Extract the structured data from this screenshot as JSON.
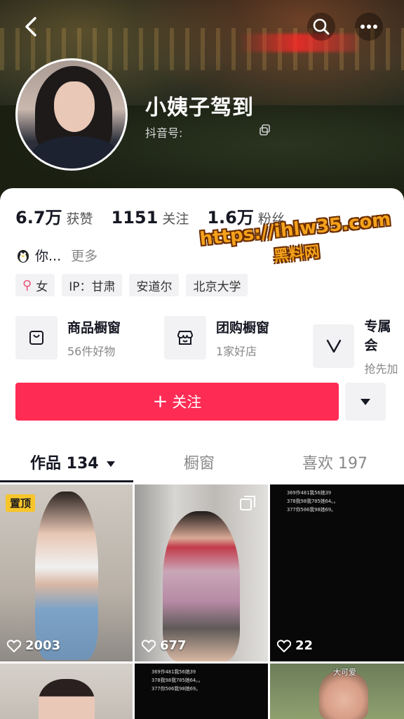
{
  "header": {
    "back_icon": "back-chevron-icon",
    "search_icon": "search-icon",
    "more_icon": "more-dots-icon"
  },
  "profile": {
    "nickname": "小姨子驾到",
    "douyin_id_label": "抖音号:",
    "stats": [
      {
        "num": "6.7万",
        "label": "获赞"
      },
      {
        "num": "1151",
        "label": "关注"
      },
      {
        "num": "1.6万",
        "label": "粉丝"
      }
    ],
    "bio_text": "你...",
    "bio_more": "更多",
    "tags": {
      "gender": "女",
      "ip": "IP：甘肃",
      "location": "安道尔",
      "school": "北京大学"
    }
  },
  "watermark": {
    "url": "https://ihlw35.com",
    "cn": "黑料网"
  },
  "shop": [
    {
      "title": "商品橱窗",
      "sub": "56件好物",
      "icon": "bag-icon"
    },
    {
      "title": "团购橱窗",
      "sub": "1家好店",
      "icon": "store-icon"
    },
    {
      "title": "专属会",
      "sub": "抢先加",
      "icon": "v-icon"
    }
  ],
  "actions": {
    "follow_label": "关注",
    "follow_plus": "+"
  },
  "tabs": [
    {
      "label": "作品 134"
    },
    {
      "label": "橱窗"
    },
    {
      "label": "喜欢 197"
    }
  ],
  "videos": [
    {
      "likes": "2003",
      "pin": "置顶"
    },
    {
      "likes": "677"
    },
    {
      "likes": "22",
      "overlay": [
        "369作481我56她39",
        "378我98我705她64。。",
        "377你506我98她69。"
      ]
    },
    {
      "likes": ""
    },
    {
      "likes": "",
      "overlay": [
        "369作481我56她39",
        "378我98我705她64。。",
        "377你506我98她69。"
      ]
    },
    {
      "likes": "",
      "caption": "大可爱"
    }
  ],
  "colors": {
    "accent": "#fe2c55",
    "pin": "#f7c52b",
    "watermark": "#f4a21b"
  }
}
